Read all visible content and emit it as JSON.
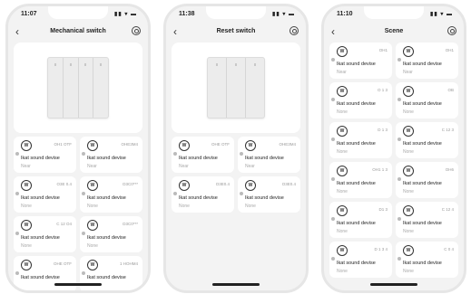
{
  "phones": [
    {
      "time": "11:07",
      "status_icons": "▮▮ ▾ ▬",
      "title": "Mechanical switch",
      "cards": [
        {
          "code": "OH1 OTF",
          "name": "Ikat sound devise",
          "sub": "Near"
        },
        {
          "code": "OHE3M4",
          "name": "Ikat sound devise",
          "sub": "Near"
        },
        {
          "code": "O3E 0.4",
          "name": "Ikat sound devise",
          "sub": "None"
        },
        {
          "code": "D3C0***",
          "name": "Ikat sound devise",
          "sub": "None"
        },
        {
          "code": "C 12 O4",
          "name": "Ikat sound devise",
          "sub": "None"
        },
        {
          "code": "D3C0***",
          "name": "Ikat sound devise",
          "sub": "None"
        },
        {
          "code": "OHE OTF",
          "name": "Ikat sound devise",
          "sub": ""
        },
        {
          "code": "1 HOHM4",
          "name": "Ikat sound devise",
          "sub": ""
        }
      ]
    },
    {
      "time": "11:38",
      "status_icons": "▮▮ ▾ ▬",
      "title": "Reset switch",
      "cards": [
        {
          "code": "OHE OTF",
          "name": "Ikat sound devise",
          "sub": "Near"
        },
        {
          "code": "OHE3M4",
          "name": "Ikat sound devise",
          "sub": "Near"
        },
        {
          "code": "O3E0.4",
          "name": "Ikat sound devise",
          "sub": "None"
        },
        {
          "code": "O3E0.4",
          "name": "Ikat sound devise",
          "sub": "None"
        }
      ]
    },
    {
      "time": "11:10",
      "status_icons": "▮▮ ▾ ▬",
      "title": "Scene",
      "cards": [
        {
          "code": "OH1",
          "name": "Ikat sound devise",
          "sub": "Near"
        },
        {
          "code": "OH1",
          "name": "Ikat sound devise",
          "sub": "Near"
        },
        {
          "code": "O 1 3",
          "name": "Ikat sound devise",
          "sub": "None"
        },
        {
          "code": "OB",
          "name": "Ikat sound devise",
          "sub": "None"
        },
        {
          "code": "D 1 3",
          "name": "Ikat sound devise",
          "sub": "None"
        },
        {
          "code": "C 12 3",
          "name": "Ikat sound devise",
          "sub": "None"
        },
        {
          "code": "OH1 1 3",
          "name": "Ikat sound devise",
          "sub": "None"
        },
        {
          "code": "OH6",
          "name": "Ikat sound devise",
          "sub": "None"
        },
        {
          "code": "D1 3",
          "name": "Ikat sound devise",
          "sub": "None"
        },
        {
          "code": "C 12 4",
          "name": "Ikat sound devise",
          "sub": "None"
        },
        {
          "code": "D 1 3 4",
          "name": "Ikat sound devise",
          "sub": "None"
        },
        {
          "code": "C 0 4",
          "name": "Ikat sound devise",
          "sub": "None"
        }
      ]
    }
  ],
  "icon_names": {
    "back": "chevron-left-icon",
    "settings": "gear-icon",
    "device": "device-icon"
  }
}
